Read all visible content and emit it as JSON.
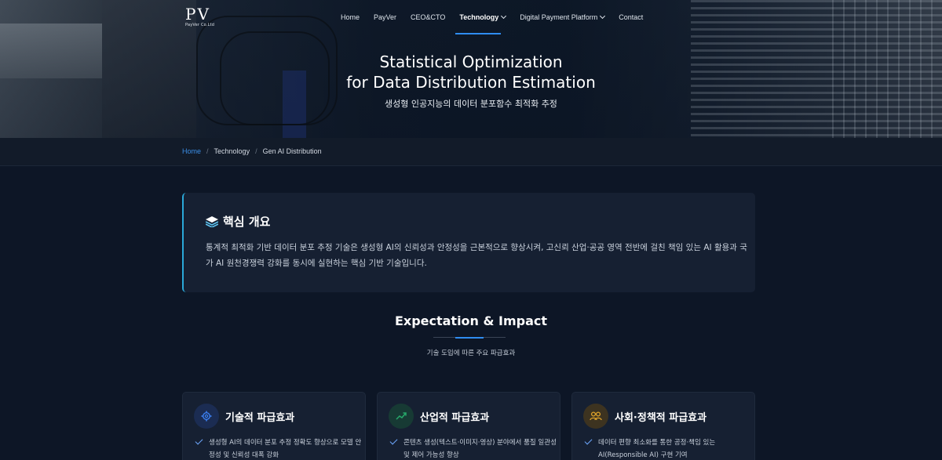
{
  "nav": {
    "logo": {
      "mark": "PV",
      "sub": "PayVer Co.Ltd"
    },
    "items": [
      {
        "label": "Home",
        "dropdown": false,
        "active": false
      },
      {
        "label": "PayVer",
        "dropdown": false,
        "active": false
      },
      {
        "label": "CEO&CTO",
        "dropdown": false,
        "active": false
      },
      {
        "label": "Technology",
        "dropdown": true,
        "active": true
      },
      {
        "label": "Digital Payment Platform",
        "dropdown": true,
        "active": false
      },
      {
        "label": "Contact",
        "dropdown": false,
        "active": false
      }
    ]
  },
  "hero": {
    "title_line1": "Statistical Optimization",
    "title_line2": "for Data Distribution Estimation",
    "subtitle": "생성형 인공지능의 데이터 분포함수 최적화 추정"
  },
  "breadcrumb": [
    "Home",
    "Technology",
    "Gen AI Distribution"
  ],
  "overview": {
    "icon": "layers-icon",
    "title": "핵심 개요",
    "body": "통계적 최적화 기반 데이터 분포 추정 기술은 생성형 AI의 신뢰성과 안정성을 근본적으로 향상시켜, 고신뢰 산업·공공 영역 전반에 걸친 책임 있는 AI 활용과 국가 AI 원천경쟁력 강화를 동시에 실현하는 핵심 기반 기술입니다."
  },
  "impact": {
    "title": "Expectation & Impact",
    "subtitle": "기술 도입에 따른 주요 파급효과",
    "cards": [
      {
        "icon": "gear-icon",
        "icon_color": "#3b7ff0",
        "title": "기술적 파급효과",
        "item": "생성형 AI의 데이터 분포 추정 정확도 향상으로 모델 안정성 및 신뢰성 대폭 강화"
      },
      {
        "icon": "trend-up-icon",
        "icon_color": "#27a86a",
        "title": "산업적 파급효과",
        "item": "콘텐츠 생성(텍스트·이미지·영상) 분야에서 품질 일관성 및 제어 가능성 향상"
      },
      {
        "icon": "people-icon",
        "icon_color": "#e0a32a",
        "title": "사회·정책적 파급효과",
        "item": "데이터 편향 최소화를 통한 공정·책임 있는 AI(Responsible AI) 구현 기여"
      }
    ]
  }
}
